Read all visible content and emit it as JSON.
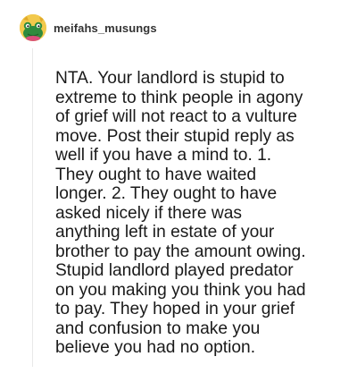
{
  "comment": {
    "author": {
      "username": "meifahs_musungs",
      "avatar_icon": "frog-avatar-icon"
    },
    "text": "NTA. Your landlord is stupid to\nextreme to think people in agony\nof grief will not react to a vulture\nmove. Post their stupid reply as\nwell if you have a mind to. 1.\nThey ought to have waited\nlonger. 2. They ought to have\nasked nicely if there was\nanything left in estate of your\nbrother to pay the amount owing.\nStupid landlord played predator\non you making you think you had\nto pay. They hoped in your grief\nand confusion to make you\nbelieve you had no option."
  },
  "colors": {
    "avatar_bg": "#f2c94c",
    "avatar_frog": "#2e8b3e",
    "text": "#1a1a1a",
    "username": "#333333",
    "thread_line": "#e8e8e8"
  }
}
